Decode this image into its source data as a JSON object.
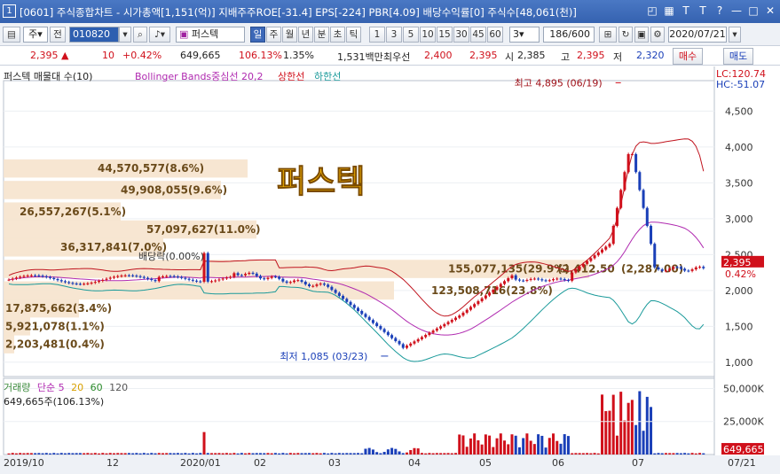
{
  "title": {
    "num": "1",
    "text": "[0601] 주식종합차트 - 시가총액[1,151(억)] 지배주주ROE[-31.4] EPS[-224] PBR[4.09] 배당수익률[0] 주식수[48,061(천)]",
    "icons": [
      "restore-icon",
      "grid-icon",
      "t-up-icon",
      "t-down-icon",
      "help-icon",
      "minimize-icon",
      "maximize-icon",
      "close-icon"
    ],
    "icon_glyphs": [
      "◰",
      "▦",
      "T",
      "T",
      "?",
      "—",
      "□",
      "✕"
    ]
  },
  "toolbar": {
    "market": "주",
    "prev": "전",
    "code": "010820",
    "stock_name": "퍼스텍",
    "periods": [
      "일",
      "주",
      "월",
      "년",
      "분",
      "초",
      "틱"
    ],
    "active_period": "일",
    "intervals": [
      "1",
      "3",
      "5",
      "10",
      "15",
      "30",
      "45",
      "60"
    ],
    "interval_value": "3",
    "count": "186",
    "count_total": "/600",
    "date": "2020/07/21"
  },
  "quote": {
    "price": "2,395",
    "arrow": "▲",
    "change": "10",
    "change_pct": "+0.42%",
    "volume": "649,665",
    "vol_ratio": "106.13%",
    "turnover": "1.35%",
    "amount": "1,531백만",
    "best_label": "최우선",
    "best_ask": "2,400",
    "best_bid": "2,395",
    "open_label": "시",
    "open": "2,385",
    "high_label": "고",
    "high": "2,395",
    "low_label": "저",
    "low": "2,320",
    "buy": "매수",
    "sell": "매도"
  },
  "legend": {
    "main": "퍼스텍 매물대 수(10)",
    "bb": "Bollinger Bands중심선 20,2",
    "upper": "상한선",
    "lower": "하한선"
  },
  "axis": {
    "lc": "LC:120.74",
    "hc": "HC:-51.07",
    "price_ticks": [
      "4,500",
      "4,000",
      "3,500",
      "3,000",
      "2,500",
      "2,000",
      "1,500",
      "1,000"
    ],
    "current_price": "2,395",
    "current_pct": "0.42%",
    "vol_ticks": [
      "50,000K",
      "25,000K"
    ],
    "current_vol": "649,665",
    "current_vol_pct": "106.13%",
    "x_labels": [
      "2019/10",
      "12",
      "2020/01",
      "02",
      "03",
      "04",
      "05",
      "06",
      "07"
    ],
    "x_end": "07/21"
  },
  "chart_data": {
    "type": "candlestick",
    "series_names": [
      "퍼스텍",
      "Bollinger Bands중심선 20,2",
      "상한선",
      "하한선"
    ],
    "ylim": [
      800,
      4900
    ],
    "volume_profile": [
      {
        "label": "44,570,577(8.6%)",
        "price": 3700
      },
      {
        "label": "49,908,055(9.6%)",
        "price": 3400
      },
      {
        "label": "26,557,267(5.1%)",
        "price": 3100
      },
      {
        "label": "57,097,627(11.0%)",
        "price": 2850
      },
      {
        "label": "36,317,841(7.0%)",
        "price": 2600
      },
      {
        "label": "155,077,135(29.9%)",
        "price": 2300
      },
      {
        "label": "123,508,716(23.8%)",
        "price": 2000
      },
      {
        "label": "17,875,662(3.4%)",
        "price": 1750
      },
      {
        "label": "5,921,078(1.1%)",
        "price": 1500
      },
      {
        "label": "2,203,481(0.4%)",
        "price": 1250
      }
    ],
    "vp_extra": [
      "(2,412.50",
      "(2,287.00)"
    ],
    "annotations": {
      "high": "최고 4,895 (06/19)",
      "low": "최저 1,085 (03/23)",
      "dividend": "배당락(0.00%)"
    },
    "volume": {
      "label": "거래량",
      "ma": "단순",
      "ma_periods": [
        "5",
        "20",
        "60",
        "120"
      ],
      "current": "649,665주(106.13%)"
    }
  },
  "watermark": "퍼스텍"
}
